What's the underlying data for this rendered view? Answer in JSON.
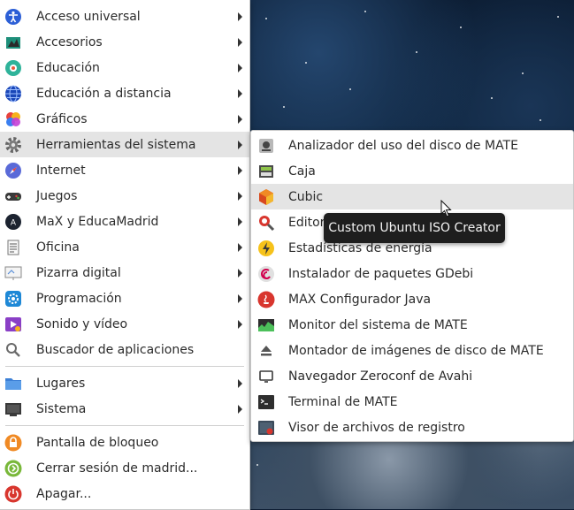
{
  "main_menu": {
    "items": [
      {
        "label": "Acceso universal",
        "icon": "accessibility-icon",
        "submenu": true
      },
      {
        "label": "Accesorios",
        "icon": "accessories-icon",
        "submenu": true
      },
      {
        "label": "Educación",
        "icon": "education-icon",
        "submenu": true
      },
      {
        "label": "Educación a distancia",
        "icon": "globe-icon",
        "submenu": true
      },
      {
        "label": "Gráficos",
        "icon": "graphics-icon",
        "submenu": true
      },
      {
        "label": "Herramientas del sistema",
        "icon": "gear-icon",
        "submenu": true,
        "highlighted": true
      },
      {
        "label": "Internet",
        "icon": "compass-icon",
        "submenu": true
      },
      {
        "label": "Juegos",
        "icon": "gamepad-icon",
        "submenu": true
      },
      {
        "label": "MaX y EducaMadrid",
        "icon": "max-logo-icon",
        "submenu": true
      },
      {
        "label": "Oficina",
        "icon": "document-icon",
        "submenu": true
      },
      {
        "label": "Pizarra digital",
        "icon": "whiteboard-icon",
        "submenu": true
      },
      {
        "label": "Programación",
        "icon": "programming-icon",
        "submenu": true
      },
      {
        "label": "Sonido y vídeo",
        "icon": "multimedia-icon",
        "submenu": true
      },
      {
        "label": "Buscador de aplicaciones",
        "icon": "search-icon",
        "submenu": false
      }
    ],
    "places": [
      {
        "label": "Lugares",
        "icon": "folder-icon",
        "submenu": true
      },
      {
        "label": "Sistema",
        "icon": "monitor-icon",
        "submenu": true
      }
    ],
    "session": [
      {
        "label": "Pantalla de bloqueo",
        "icon": "lock-icon"
      },
      {
        "label": "Cerrar sesión de madrid...",
        "icon": "logout-icon"
      },
      {
        "label": "Apagar...",
        "icon": "power-icon"
      }
    ]
  },
  "submenu": {
    "items": [
      {
        "label": "Analizador del uso del disco de MATE",
        "icon": "disk-usage-icon"
      },
      {
        "label": "Caja",
        "icon": "file-manager-icon"
      },
      {
        "label": "Cubic",
        "icon": "cubic-icon",
        "highlighted": true
      },
      {
        "label": "Editor de dconf",
        "icon": "dconf-editor-icon"
      },
      {
        "label": "Estadísticas de energía",
        "icon": "power-statistics-icon"
      },
      {
        "label": "Instalador de paquetes GDebi",
        "icon": "debian-swirl-icon"
      },
      {
        "label": "MAX Configurador Java",
        "icon": "java-icon"
      },
      {
        "label": "Monitor del sistema de MATE",
        "icon": "system-monitor-icon"
      },
      {
        "label": "Montador de imágenes de disco de MATE",
        "icon": "disk-image-mounter-icon"
      },
      {
        "label": "Navegador Zeroconf de Avahi",
        "icon": "avahi-icon"
      },
      {
        "label": "Terminal de MATE",
        "icon": "terminal-icon"
      },
      {
        "label": "Visor de archivos de registro",
        "icon": "log-viewer-icon"
      }
    ]
  },
  "tooltip": {
    "text": "Custom Ubuntu ISO Creator"
  }
}
